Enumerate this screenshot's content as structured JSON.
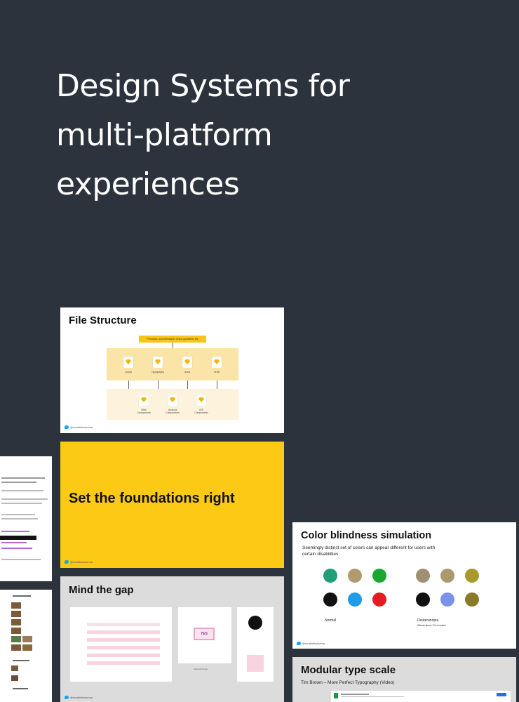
{
  "hero": {
    "title_lines": [
      "Design Systems for",
      "multi-platform",
      "experiences"
    ]
  },
  "slides": {
    "file_structure": {
      "title": "File Structure",
      "top_box": "Principles, documentation, brand guidelines etc",
      "row1": [
        "Colors",
        "Typography",
        "Icons",
        "Grids"
      ],
      "row2": [
        "Web\nComponents",
        "Android\nComponents",
        "iOS\nComponents"
      ],
      "twitter": "@mrakhilsukumar"
    },
    "foundations": {
      "title": "Set the foundations right",
      "twitter": "@mrakhilsukumar"
    },
    "gap": {
      "title": "Mind the gap",
      "yes_label": "YES",
      "caption": "Material Design",
      "twitter": "@mrakhilsukumar"
    },
    "color": {
      "title": "Color blindness simulation",
      "subtitle": "Seemingly distinct set of colors can appear different for users with certain disabilities",
      "normal_label": "Normal",
      "deut_label": "Deuteranopia",
      "deut_note": "Affects about 1% of males",
      "normal_colors": [
        "#1f9e7a",
        "#b09a6e",
        "#1aa832",
        "#111111",
        "#1e9ce8",
        "#e01e22"
      ],
      "deut_colors": [
        "#9e9070",
        "#a89a6c",
        "#a89a2c",
        "#111111",
        "#7a92e8",
        "#8a7a28"
      ],
      "twitter": "@mrakhilsukumar"
    },
    "type": {
      "title": "Modular type scale",
      "subtitle": "Tim Brown – More Perfect Typography (Video)"
    }
  }
}
